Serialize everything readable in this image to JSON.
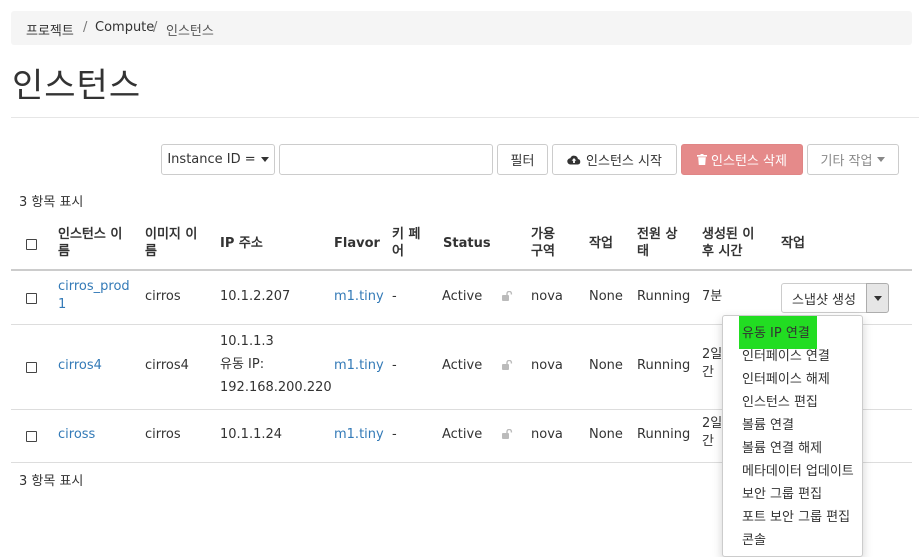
{
  "breadcrumb": {
    "items": [
      "프로젝트",
      "Compute",
      "인스턴스"
    ],
    "separator": "/"
  },
  "page": {
    "title": "인스턴스"
  },
  "toolbar": {
    "filter_select": "Instance ID =",
    "filter_value": "",
    "filter_button": "필터",
    "start_button": "인스턴스 시작",
    "delete_button": "인스턴스 삭제",
    "more_button": "기타 작업"
  },
  "count_top": "3 항목 표시",
  "count_bottom": "3 항목 표시",
  "table": {
    "headers": {
      "name": [
        "인스턴스 이",
        "름"
      ],
      "image": [
        "이미지 이",
        "름"
      ],
      "ip": "IP 주소",
      "flavor": "Flavor",
      "keypair": [
        "키 페",
        "어"
      ],
      "status": "Status",
      "zone": [
        "가용",
        "구역"
      ],
      "task": "작업",
      "power": [
        "전원 상",
        "태"
      ],
      "age": [
        "생성된 이",
        "후 시간"
      ],
      "actions": "작업"
    },
    "rows": [
      {
        "name": [
          "cirros_prod",
          "1"
        ],
        "image": "cirros",
        "ip": [
          "10.1.2.207"
        ],
        "flavor": "m1.tiny",
        "keypair": "-",
        "status": "Active",
        "zone": "nova",
        "task": "None",
        "power": "Running",
        "age": [
          "7분"
        ]
      },
      {
        "name": [
          "cirros4"
        ],
        "image": "cirros4",
        "ip": [
          "10.1.1.3",
          "유동 IP:",
          "192.168.200.220"
        ],
        "flavor": "m1.tiny",
        "keypair": "-",
        "status": "Active",
        "zone": "nova",
        "task": "None",
        "power": "Running",
        "age": [
          "2일",
          "간"
        ]
      },
      {
        "name": [
          "ciross"
        ],
        "image": "cirros",
        "ip": [
          "10.1.1.24"
        ],
        "flavor": "m1.tiny",
        "keypair": "-",
        "status": "Active",
        "zone": "nova",
        "task": "None",
        "power": "Running",
        "age": [
          "2일",
          "간"
        ]
      }
    ],
    "snapshot_button": "스냅샷 생성"
  },
  "dropdown": {
    "items": [
      "유동 IP 연결",
      "인터페이스 연결",
      "인터페이스 해제",
      "인스턴스 편집",
      "볼륨 연결",
      "볼륨 연결 해제",
      "메타데이터 업데이트",
      "보안 그룹 편집",
      "포트 보안 그룹 편집",
      "콘솔"
    ],
    "highlight_color": "#22dd22"
  },
  "icons": {
    "upload": "cloud-upload-icon",
    "trash": "trash-icon",
    "lock": "lock-icon",
    "caret": "caret-down-icon"
  },
  "colors": {
    "link": "#337ab7",
    "danger": "#e58a8a",
    "breadcrumb_bg": "#f5f5f5"
  }
}
